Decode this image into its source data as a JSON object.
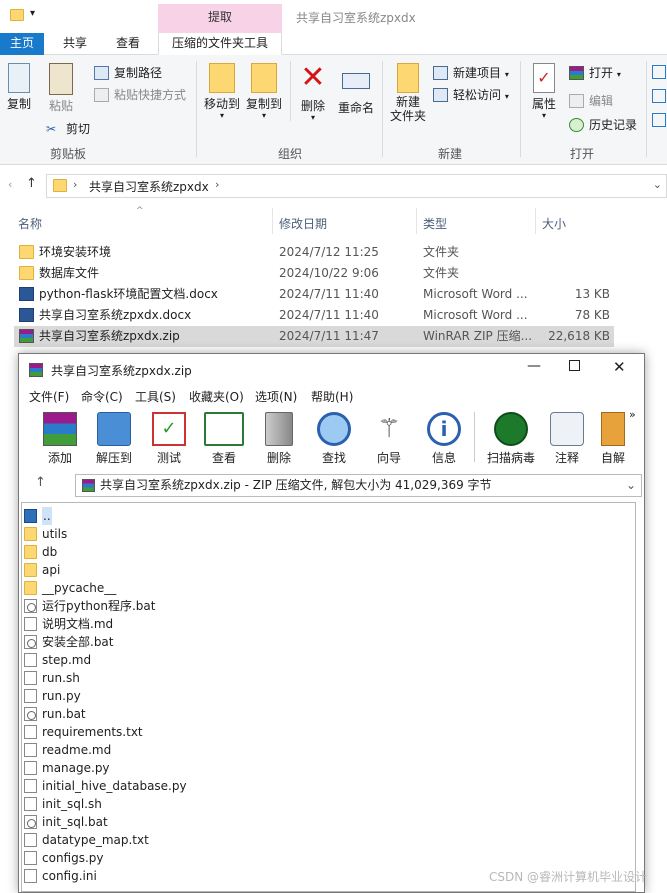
{
  "explorer": {
    "extract_tab": "提取",
    "window_title": "共享自习室系统zpxdx",
    "tabs": {
      "home": "主页",
      "share": "共享",
      "view": "查看",
      "compress_tools": "压缩的文件夹工具"
    },
    "ribbon": {
      "clipboard": {
        "copy": "复制",
        "paste": "粘贴",
        "copy_path": "复制路径",
        "paste_shortcut": "粘贴快捷方式",
        "cut": "剪切",
        "group": "剪贴板"
      },
      "organize": {
        "move_to": "移动到",
        "copy_to": "复制到",
        "delete": "删除",
        "rename": "重命名",
        "group": "组织"
      },
      "new": {
        "new_folder": "新建\n文件夹",
        "new_item": "新建项目",
        "easy_access": "轻松访问",
        "group": "新建"
      },
      "open": {
        "properties": "属性",
        "open": "打开",
        "edit": "编辑",
        "history": "历史记录",
        "group": "打开"
      }
    },
    "address": {
      "path": "共享自习室系统zpxdx"
    },
    "columns": {
      "name": "名称",
      "date": "修改日期",
      "type": "类型",
      "size": "大小"
    },
    "files": [
      {
        "name": "环境安装环境",
        "date": "2024/7/12 11:25",
        "type": "文件夹",
        "size": "",
        "icon": "folder-icon"
      },
      {
        "name": "数据库文件",
        "date": "2024/10/22 9:06",
        "type": "文件夹",
        "size": "",
        "icon": "folder-icon"
      },
      {
        "name": "python-flask环境配置文档.docx",
        "date": "2024/7/11 11:40",
        "type": "Microsoft Word ...",
        "size": "13 KB",
        "icon": "word-icon"
      },
      {
        "name": "共享自习室系统zpxdx.docx",
        "date": "2024/7/11 11:40",
        "type": "Microsoft Word ...",
        "size": "78 KB",
        "icon": "word-icon"
      },
      {
        "name": "共享自习室系统zpxdx.zip",
        "date": "2024/7/11 11:47",
        "type": "WinRAR ZIP 压缩...",
        "size": "22,618 KB",
        "icon": "winrar-icon"
      }
    ]
  },
  "winrar": {
    "title": "共享自习室系统zpxdx.zip",
    "menu": [
      "文件(F)",
      "命令(C)",
      "工具(S)",
      "收藏夹(O)",
      "选项(N)",
      "帮助(H)"
    ],
    "toolbar": [
      "添加",
      "解压到",
      "测试",
      "查看",
      "删除",
      "查找",
      "向导",
      "信息",
      "扫描病毒",
      "注释",
      "自解"
    ],
    "path_text": "共享自习室系统zpxdx.zip - ZIP 压缩文件, 解包大小为 41,029,369 字节",
    "items": [
      {
        "name": "..",
        "icon": "up-folder-icon"
      },
      {
        "name": "utils",
        "icon": "folder-icon"
      },
      {
        "name": "db",
        "icon": "folder-icon"
      },
      {
        "name": "api",
        "icon": "folder-icon"
      },
      {
        "name": "__pycache__",
        "icon": "folder-icon"
      },
      {
        "name": "运行python程序.bat",
        "icon": "bat-icon"
      },
      {
        "name": "说明文档.md",
        "icon": "file-icon"
      },
      {
        "name": "安装全部.bat",
        "icon": "bat-icon"
      },
      {
        "name": "step.md",
        "icon": "file-icon"
      },
      {
        "name": "run.sh",
        "icon": "file-icon"
      },
      {
        "name": "run.py",
        "icon": "file-icon"
      },
      {
        "name": "run.bat",
        "icon": "bat-icon"
      },
      {
        "name": "requirements.txt",
        "icon": "file-icon"
      },
      {
        "name": "readme.md",
        "icon": "file-icon"
      },
      {
        "name": "manage.py",
        "icon": "file-icon"
      },
      {
        "name": "initial_hive_database.py",
        "icon": "file-icon"
      },
      {
        "name": "init_sql.sh",
        "icon": "file-icon"
      },
      {
        "name": "init_sql.bat",
        "icon": "bat-icon"
      },
      {
        "name": "datatype_map.txt",
        "icon": "file-icon"
      },
      {
        "name": "configs.py",
        "icon": "file-icon"
      },
      {
        "name": "config.ini",
        "icon": "file-icon"
      }
    ]
  },
  "watermark": "CSDN @睿洲计算机毕业设计"
}
